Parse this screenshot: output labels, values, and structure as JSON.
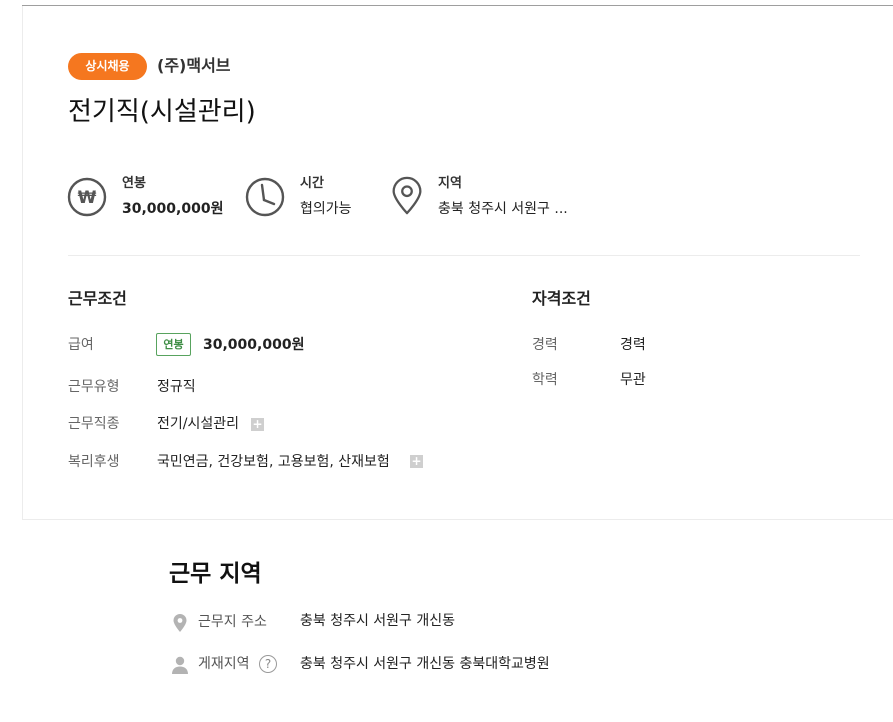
{
  "header": {
    "badge": "상시채용",
    "company": "(주)맥서브",
    "title": "전기직(시설관리)"
  },
  "summary": [
    {
      "icon": "won-icon",
      "label": "연봉",
      "value": "30,000,000원"
    },
    {
      "icon": "clock-icon",
      "label": "시간",
      "value": "협의가능"
    },
    {
      "icon": "location-pin-icon",
      "label": "지역",
      "value": "충북 청주시 서원구 ..."
    }
  ],
  "conditions": {
    "title": "근무조건",
    "salary_label": "급여",
    "salary_type": "연봉",
    "salary_value": "30,000,000원",
    "type_label": "근무유형",
    "type_value": "정규직",
    "job_label": "근무직종",
    "job_value": "전기/시설관리",
    "benefit_label": "복리후생",
    "benefit_value": "국민연금, 건강보험, 고용보험, 산재보험",
    "plus_symbol": "+"
  },
  "qualifications": {
    "title": "자격조건",
    "career_label": "경력",
    "career_value": "경력",
    "edu_label": "학력",
    "edu_value": "무관"
  },
  "location": {
    "title": "근무 지역",
    "address_label": "근무지 주소",
    "address_value": "충북 청주시 서원구 개신동",
    "posting_label": "게재지역",
    "help_symbol": "?",
    "posting_value": "충북 청주시 서원구 개신동 충북대학교병원"
  },
  "colors": {
    "accent": "#f5771f",
    "salary_tag": "#3f8e46",
    "icon_gray": "#555555"
  }
}
